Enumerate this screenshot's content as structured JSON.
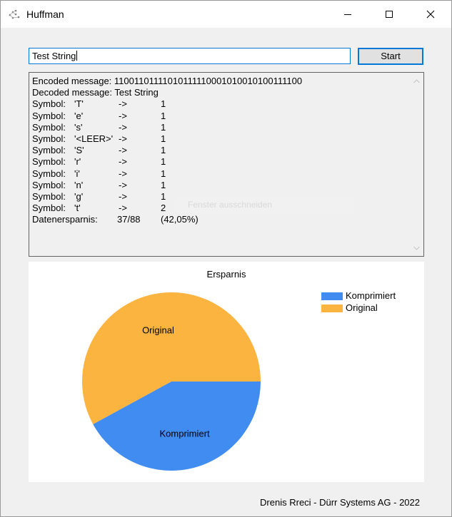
{
  "window": {
    "title": "Huffman",
    "icon": "huffman-app-icon",
    "controls": {
      "minimize": "minimize-icon",
      "maximize": "maximize-icon",
      "close": "close-icon"
    }
  },
  "input": {
    "value": "Test String"
  },
  "start_button": {
    "label": "Start"
  },
  "output": {
    "encoded_label": "Encoded message:",
    "encoded_value": "11001101111010111110001010010100111100",
    "decoded_label": "Decoded message:",
    "decoded_value": "Test String",
    "symbols": [
      {
        "label": "Symbol:",
        "char": "'T'",
        "arrow": "->",
        "count": "1"
      },
      {
        "label": "Symbol:",
        "char": "'e'",
        "arrow": "->",
        "count": "1"
      },
      {
        "label": "Symbol:",
        "char": "'s'",
        "arrow": "->",
        "count": "1"
      },
      {
        "label": "Symbol:",
        "char": "'<LEER>'",
        "arrow": "->",
        "count": "1"
      },
      {
        "label": "Symbol:",
        "char": "'S'",
        "arrow": "->",
        "count": "1"
      },
      {
        "label": "Symbol:",
        "char": "'r'",
        "arrow": "->",
        "count": "1"
      },
      {
        "label": "Symbol:",
        "char": "'i'",
        "arrow": "->",
        "count": "1"
      },
      {
        "label": "Symbol:",
        "char": "'n'",
        "arrow": "->",
        "count": "1"
      },
      {
        "label": "Symbol:",
        "char": "'g'",
        "arrow": "->",
        "count": "1"
      },
      {
        "label": "Symbol:",
        "char": "'t'",
        "arrow": "->",
        "count": "2"
      }
    ],
    "savings_label": "Datenersparnis:",
    "savings_fraction": "37/88",
    "savings_percent": "(42,05%)"
  },
  "ghost_text": "Fenster ausschneiden",
  "chart_data": {
    "type": "pie",
    "title": "Ersparnis",
    "slices": [
      {
        "name": "Komprimiert",
        "value": 42.05,
        "color": "#418cf0"
      },
      {
        "name": "Original",
        "value": 57.95,
        "color": "#fcb441"
      }
    ],
    "legend": "top-right"
  },
  "footer": {
    "text": "Drenis Rreci - Dürr Systems AG - 2022"
  }
}
